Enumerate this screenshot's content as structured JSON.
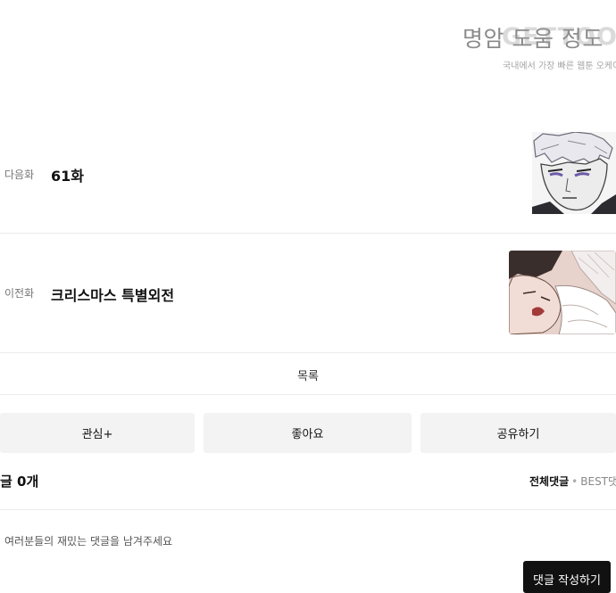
{
  "header": {
    "title": "명암 도움 정도",
    "logo_text": "GETTOON",
    "subtitle": "국내에서 가장 빠른 웹툰 오케이"
  },
  "episode_nav": {
    "next": {
      "label": "다음화",
      "title": "61화"
    },
    "prev": {
      "label": "이전화",
      "title": "크리스마스 특별외전"
    }
  },
  "list_button": "목록",
  "actions": [
    {
      "label": "관심+"
    },
    {
      "label": "좋아요"
    },
    {
      "label": "공유하기"
    }
  ],
  "comments": {
    "count": "글 0개",
    "tab_all": "전체댓글",
    "tab_separator": "•",
    "tab_best": "BEST댓",
    "placeholder": "여러분들의 재밌는 댓글을 남겨주세요",
    "write_button": "댓글 작성하기"
  }
}
